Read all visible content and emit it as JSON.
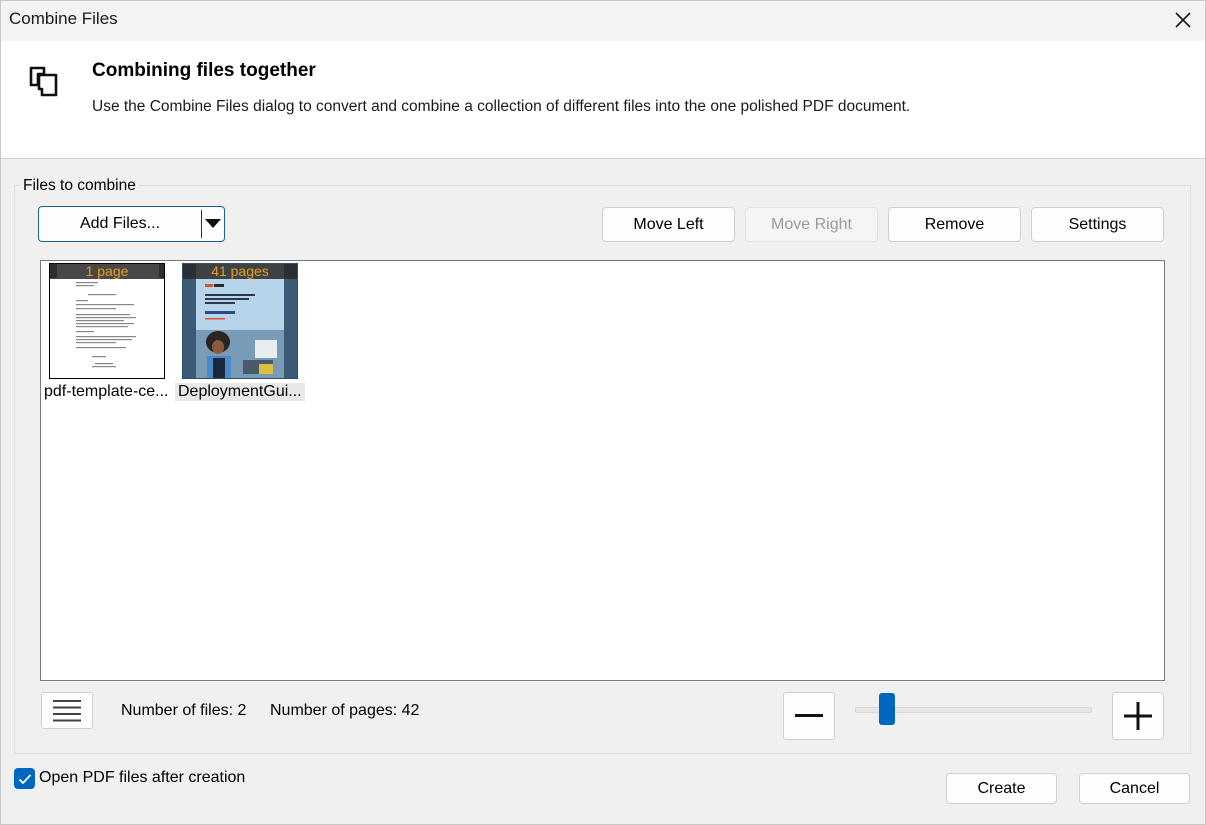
{
  "window": {
    "title": "Combine Files"
  },
  "header": {
    "title": "Combining files together",
    "description": "Use the Combine Files dialog to convert and combine a collection of different files into the one polished PDF document."
  },
  "group": {
    "label": "Files to combine"
  },
  "toolbar": {
    "add_files": "Add Files...",
    "move_left": "Move Left",
    "move_right": "Move Right",
    "remove": "Remove",
    "settings": "Settings"
  },
  "files": [
    {
      "name": "pdf-template-ce...",
      "pages_badge": "1 page"
    },
    {
      "name": "DeploymentGui...",
      "pages_badge": "41 pages",
      "selected": true
    }
  ],
  "status": {
    "num_files": "Number of files: 2",
    "num_pages": "Number of pages: 42"
  },
  "zoom": {
    "level": 0.13
  },
  "options": {
    "open_after_creation_label": "Open PDF files after creation",
    "open_after_creation_checked": true
  },
  "footer": {
    "create": "Create",
    "cancel": "Cancel"
  },
  "colors": {
    "accent": "#0067c0",
    "badge_text": "#e5a020"
  }
}
